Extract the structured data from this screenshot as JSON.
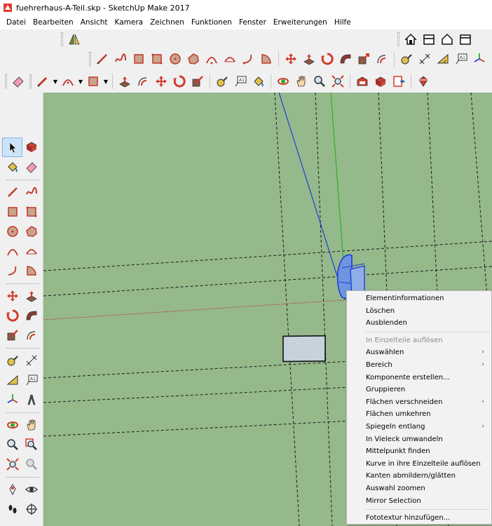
{
  "window": {
    "title": "fuehrerhaus-A-Teil.skp - SketchUp Make 2017"
  },
  "menubar": {
    "items": [
      "Datei",
      "Bearbeiten",
      "Ansicht",
      "Kamera",
      "Zeichnen",
      "Funktionen",
      "Fenster",
      "Erweiterungen",
      "Hilfe"
    ]
  },
  "context_menu": {
    "items": [
      {
        "label": "Elementinformationen"
      },
      {
        "label": "Löschen"
      },
      {
        "label": "Ausblenden"
      },
      {
        "label": "In Einzelteile auflösen",
        "disabled": true
      },
      {
        "label": "Auswählen",
        "submenu": true
      },
      {
        "label": "Bereich",
        "submenu": true
      },
      {
        "label": "Komponente erstellen..."
      },
      {
        "label": "Gruppieren"
      },
      {
        "label": "Flächen verschneiden",
        "submenu": true
      },
      {
        "label": "Flächen umkehren"
      },
      {
        "label": "Spiegeln entlang",
        "submenu": true
      },
      {
        "label": "In Vieleck umwandeln"
      },
      {
        "label": "Mittelpunkt finden"
      },
      {
        "label": "Kurve in ihre Einzelteile auflösen"
      },
      {
        "label": "Kanten abmildern/glätten"
      },
      {
        "label": "Auswahl zoomen"
      },
      {
        "label": "Mirror Selection"
      },
      {
        "label": "Fototextur hinzufügen..."
      }
    ],
    "submenu_arrow": "›"
  },
  "colors": {
    "viewport_bg": "#96b98b",
    "selection_blue": "#1f3fd8",
    "red_axis": "#c0392b",
    "green_axis": "#2eae2e",
    "icon_red": "#d23c2c"
  }
}
